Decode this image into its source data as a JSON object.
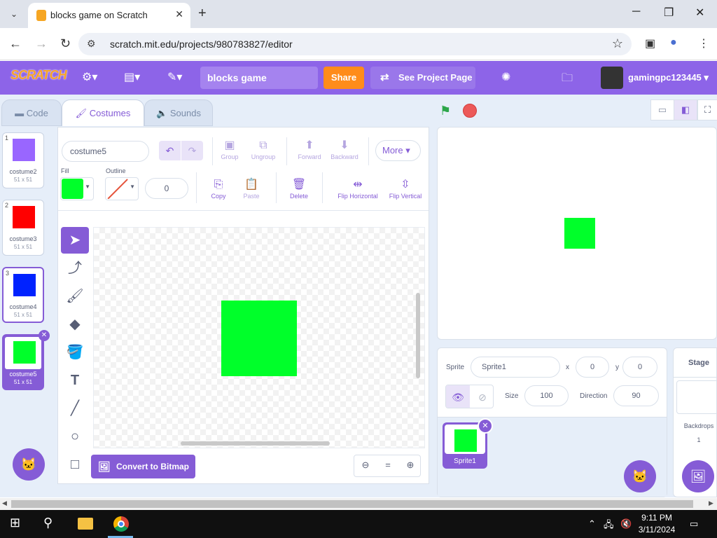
{
  "browser": {
    "tab_title": "blocks game on Scratch",
    "url": "scratch.mit.edu/projects/980783827/editor",
    "new_tab": "+",
    "close_tab": "✕"
  },
  "scratch": {
    "logo": "SCRATCH",
    "project_title": "blocks game",
    "share": "Share",
    "see_project_page": "See Project Page",
    "username": "gamingpc123445"
  },
  "tabs": {
    "code": "Code",
    "costumes": "Costumes",
    "sounds": "Sounds"
  },
  "costumes": [
    {
      "num": "1",
      "name": "costume2",
      "size": "51 x 51",
      "color": "#9966ff"
    },
    {
      "num": "2",
      "name": "costume3",
      "size": "51 x 51",
      "color": "#ff0000"
    },
    {
      "num": "3",
      "name": "costume4",
      "size": "51 x 51",
      "color": "#0022ff"
    },
    {
      "num": "4",
      "name": "costume5",
      "size": "51 x 51",
      "color": "#00ff2a"
    }
  ],
  "paint": {
    "costume_name": "costume5",
    "group": "Group",
    "ungroup": "Ungroup",
    "forward": "Forward",
    "backward": "Backward",
    "more": "More",
    "fill_label": "Fill",
    "outline_label": "Outline",
    "outline_size": "0",
    "copy": "Copy",
    "paste": "Paste",
    "delete": "Delete",
    "flip_horizontal": "Flip Horizontal",
    "flip_vertical": "Flip Vertical",
    "convert_bitmap": "Convert to Bitmap",
    "fill_color": "#00ff2a",
    "zoom_reset": "="
  },
  "sprite_info": {
    "sprite_label": "Sprite",
    "sprite_name": "Sprite1",
    "x_label": "x",
    "x": "0",
    "y_label": "y",
    "y": "0",
    "size_label": "Size",
    "size": "100",
    "direction_label": "Direction",
    "direction": "90",
    "tile_name": "Sprite1"
  },
  "stage_pane": {
    "title": "Stage",
    "backdrops_label": "Backdrops",
    "backdrops_count": "1"
  },
  "taskbar": {
    "time": "9:11 PM",
    "date": "3/11/2024"
  },
  "colors": {
    "accent": "#855cd6",
    "menubar": "#8d64e8",
    "share": "#ff8c1a",
    "sprite_green": "#00ff2a"
  }
}
